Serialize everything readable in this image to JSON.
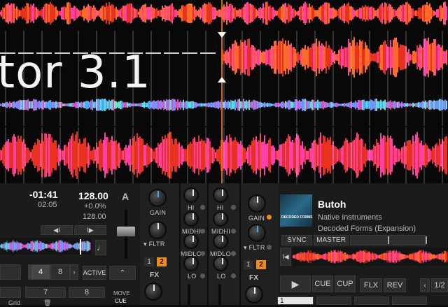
{
  "promo": {
    "title": "tor 3.1"
  },
  "deck_a": {
    "letter": "A",
    "time_remaining": "-01:41",
    "time_elapsed": "02:05",
    "bpm": "128.00",
    "pitch": "+0.0%",
    "base_bpm": "128.00",
    "beatjump_4": "4",
    "beatjump_8": "8",
    "loop_7": "7",
    "loop_8": "8",
    "active_label": "ACTIVE",
    "grid_label": "Grid",
    "move_label": "MOVE",
    "cue_label": "CUE"
  },
  "mixer": {
    "gain_label": "GAIN",
    "fltr_label": "FLTR",
    "fx_label": "FX",
    "fx1": "1",
    "fx2": "2",
    "hi_label": "HI",
    "midhi_label": "MIDHI",
    "midlo_label": "MIDLO",
    "lo_label": "LO"
  },
  "deck_b": {
    "artwork_text": "DECODED FORMS",
    "title": "Butoh",
    "artist": "Native Instruments",
    "album": "Decoded Forms (Expansion)",
    "sync_label": "SYNC",
    "master_label": "MASTER",
    "cue_label": "CUE",
    "cup_label": "CUP",
    "flx_label": "FLX",
    "rev_label": "REV",
    "loop_size": "1/2",
    "hotcue_1": "1"
  },
  "colors": {
    "accent_orange": "#f08a1c",
    "accent_blue": "#4aa8ff",
    "wave_red": "#e8321e",
    "wave_pink": "#ff3fb0"
  }
}
